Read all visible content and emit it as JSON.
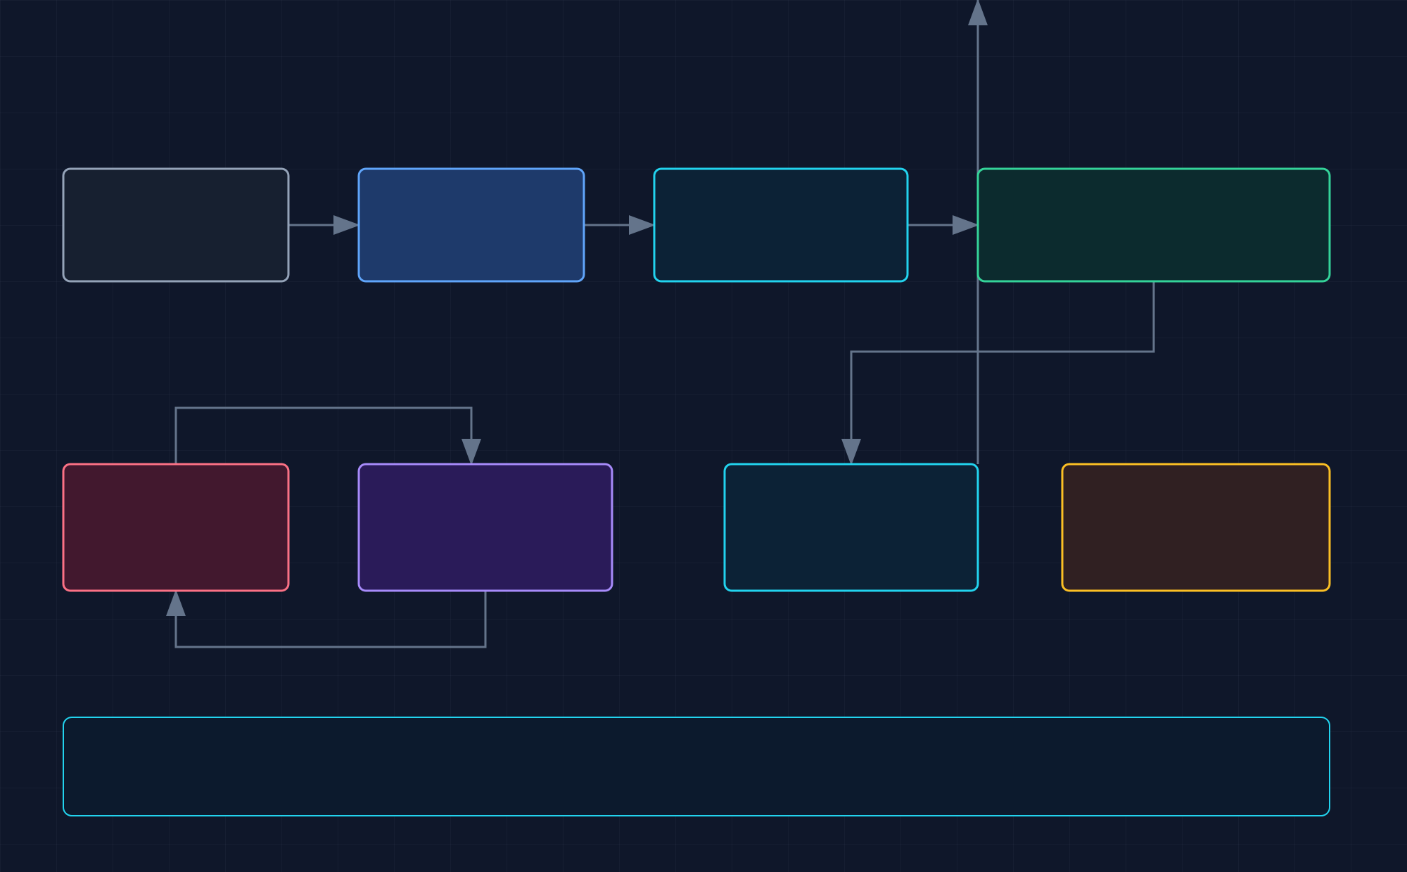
{
  "colors": {
    "background": "#0f172a",
    "connector": "#64748b"
  },
  "nodes": [
    {
      "id": "n1",
      "label": "",
      "stroke": "#94a3b8",
      "fill": "#172030"
    },
    {
      "id": "n2",
      "label": "",
      "stroke": "#60a5fa",
      "fill": "#1e3a6b"
    },
    {
      "id": "n3",
      "label": "",
      "stroke": "#22d3ee",
      "fill": "#0c2236"
    },
    {
      "id": "n4",
      "label": "",
      "stroke": "#34d399",
      "fill": "#0c2b2e"
    },
    {
      "id": "n5",
      "label": "",
      "stroke": "#fb7185",
      "fill": "#42182e"
    },
    {
      "id": "n6",
      "label": "",
      "stroke": "#a78bfa",
      "fill": "#2a1b59"
    },
    {
      "id": "n7",
      "label": "",
      "stroke": "#22d3ee",
      "fill": "#0c2236"
    },
    {
      "id": "n8",
      "label": "",
      "stroke": "#fbbf24",
      "fill": "#302022"
    },
    {
      "id": "n9",
      "label": "",
      "stroke": "#22d3ee",
      "fill": "#0c1a2d"
    }
  ],
  "edges": [
    {
      "from": "n1",
      "to": "n2"
    },
    {
      "from": "n2",
      "to": "n3"
    },
    {
      "from": "n3",
      "to": "n4"
    },
    {
      "from": "n4",
      "to": "n7"
    },
    {
      "from": "n5",
      "to": "n6"
    },
    {
      "from": "n6",
      "to": "n5"
    },
    {
      "from": "n7",
      "to": "offscreen-top"
    },
    {
      "from": "n8-interior",
      "to": "n8"
    }
  ]
}
